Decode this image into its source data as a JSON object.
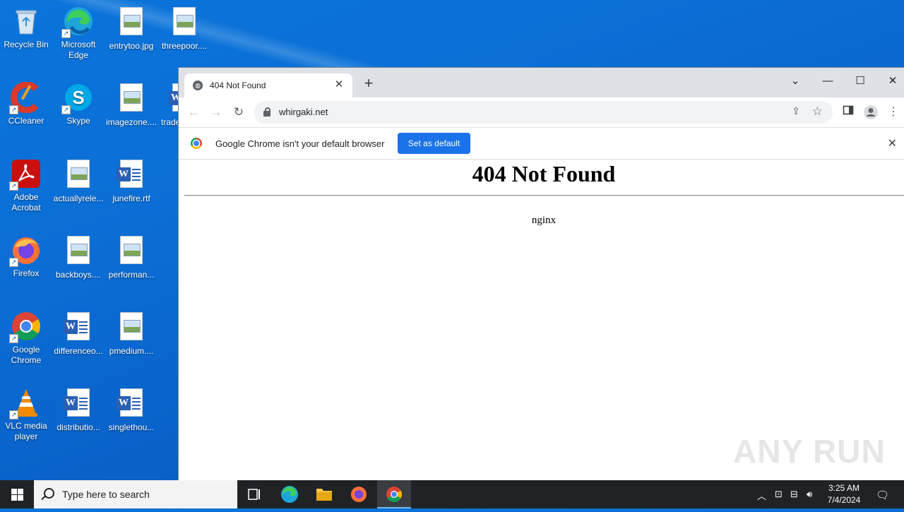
{
  "desktop": {
    "icons": [
      {
        "label": "Recycle Bin",
        "icon": "recycle-bin-icon"
      },
      {
        "label": "Microsoft Edge",
        "icon": "edge-icon"
      },
      {
        "label": "entrytoo.jpg",
        "icon": "image-file-icon"
      },
      {
        "label": "threepoor....",
        "icon": "image-file-icon"
      },
      {
        "label": "CCleaner",
        "icon": "ccleaner-icon"
      },
      {
        "label": "Skype",
        "icon": "skype-icon"
      },
      {
        "label": "imagezone....",
        "icon": "image-file-icon"
      },
      {
        "label": "trade",
        "icon": "word-file-icon"
      },
      {
        "label": "Adobe Acrobat",
        "icon": "acrobat-icon"
      },
      {
        "label": "actuallyrele...",
        "icon": "image-file-icon"
      },
      {
        "label": "junefire.rtf",
        "icon": "word-file-icon"
      },
      {
        "label": "Firefox",
        "icon": "firefox-icon"
      },
      {
        "label": "backboys....",
        "icon": "image-file-icon"
      },
      {
        "label": "performan...",
        "icon": "image-file-icon"
      },
      {
        "label": "Google Chrome",
        "icon": "chrome-icon"
      },
      {
        "label": "differenceo...",
        "icon": "word-file-icon"
      },
      {
        "label": "pmedium....",
        "icon": "image-file-icon"
      },
      {
        "label": "VLC media player",
        "icon": "vlc-icon"
      },
      {
        "label": "distributio...",
        "icon": "word-file-icon"
      },
      {
        "label": "singlethou...",
        "icon": "word-file-icon"
      }
    ]
  },
  "browser": {
    "tab_title": "404 Not Found",
    "url": "whirgaki.net",
    "infobar": {
      "message": "Google Chrome isn't your default browser",
      "button": "Set as default"
    },
    "page": {
      "heading": "404 Not Found",
      "server": "nginx"
    }
  },
  "watermark": "ANY RUN",
  "taskbar": {
    "search_placeholder": "Type here to search",
    "time": "3:25 AM",
    "date": "7/4/2024"
  }
}
